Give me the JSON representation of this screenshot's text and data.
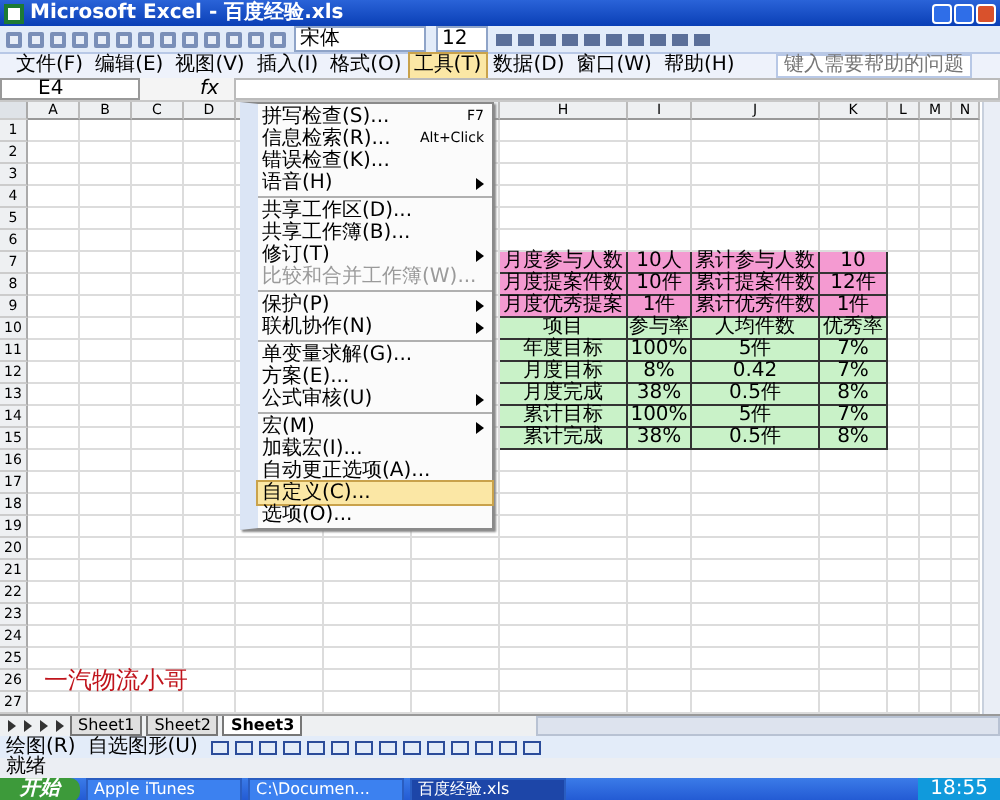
{
  "window": {
    "title": "Microsoft Excel - 百度经验.xls"
  },
  "toolbar": {
    "font": "宋体",
    "font_size": "12"
  },
  "menu_bar": [
    {
      "label": "文件(F)",
      "selected": false
    },
    {
      "label": "编辑(E)",
      "selected": false
    },
    {
      "label": "视图(V)",
      "selected": false
    },
    {
      "label": "插入(I)",
      "selected": false
    },
    {
      "label": "格式(O)",
      "selected": false
    },
    {
      "label": "工具(T)",
      "selected": true
    },
    {
      "label": "数据(D)",
      "selected": false
    },
    {
      "label": "窗口(W)",
      "selected": false
    },
    {
      "label": "帮助(H)",
      "selected": false
    }
  ],
  "help_box": {
    "placeholder": "键入需要帮助的问题"
  },
  "formula_bar": {
    "name_box": "E4",
    "function_label": "fx"
  },
  "columns": [
    "A",
    "B",
    "C",
    "D",
    "H",
    "I",
    "J",
    "K",
    "L",
    "M",
    "N"
  ],
  "rows": [
    "1",
    "2",
    "3",
    "4",
    "5",
    "6",
    "7",
    "8",
    "9",
    "10",
    "11",
    "12",
    "13",
    "14",
    "15",
    "16",
    "17",
    "18",
    "19",
    "20",
    "21",
    "22",
    "23",
    "24",
    "25",
    "26",
    "27"
  ],
  "table": {
    "rows": [
      {
        "kind": "summary",
        "cells": [
          "月度参与人数",
          "10人",
          "累计参与人数",
          "10"
        ]
      },
      {
        "kind": "summary",
        "cells": [
          "月度提案件数",
          "10件",
          "累计提案件数",
          "12件"
        ]
      },
      {
        "kind": "summary",
        "cells": [
          "月度优秀提案",
          "1件",
          "累计优秀件数",
          "1件"
        ]
      },
      {
        "kind": "data",
        "cells": [
          "项目",
          "参与率",
          "人均件数",
          "优秀率"
        ]
      },
      {
        "kind": "data",
        "cells": [
          "年度目标",
          "100%",
          "5件",
          "7%"
        ]
      },
      {
        "kind": "data",
        "cells": [
          "月度目标",
          "8%",
          "0.42",
          "7%"
        ]
      },
      {
        "kind": "data",
        "cells": [
          "月度完成",
          "38%",
          "0.5件",
          "8%"
        ]
      },
      {
        "kind": "data",
        "cells": [
          "累计目标",
          "100%",
          "5件",
          "7%"
        ]
      },
      {
        "kind": "data",
        "cells": [
          "累计完成",
          "38%",
          "0.5件",
          "8%"
        ]
      }
    ]
  },
  "caption": "一汽物流小哥",
  "tools_menu": [
    {
      "kind": "item",
      "label": "拼写检查(S)...",
      "shortcut": "F7",
      "selected": false,
      "disabled": false
    },
    {
      "kind": "item",
      "label": "信息检索(R)...",
      "shortcut": "Alt+Click",
      "selected": false,
      "disabled": false
    },
    {
      "kind": "item",
      "label": "错误检查(K)...",
      "selected": false,
      "disabled": false
    },
    {
      "kind": "submenu",
      "label": "语音(H)",
      "selected": false,
      "disabled": false
    },
    {
      "kind": "separator"
    },
    {
      "kind": "item",
      "label": "共享工作区(D)...",
      "selected": false,
      "disabled": false
    },
    {
      "kind": "item",
      "label": "共享工作簿(B)...",
      "selected": false,
      "disabled": false
    },
    {
      "kind": "submenu",
      "label": "修订(T)",
      "selected": false,
      "disabled": false
    },
    {
      "kind": "item",
      "label": "比较和合并工作簿(W)...",
      "selected": false,
      "disabled": true
    },
    {
      "kind": "separator"
    },
    {
      "kind": "submenu",
      "label": "保护(P)",
      "selected": false,
      "disabled": false
    },
    {
      "kind": "submenu",
      "label": "联机协作(N)",
      "selected": false,
      "disabled": false
    },
    {
      "kind": "separator"
    },
    {
      "kind": "item",
      "label": "单变量求解(G)...",
      "selected": false,
      "disabled": false
    },
    {
      "kind": "item",
      "label": "方案(E)...",
      "selected": false,
      "disabled": false
    },
    {
      "kind": "submenu",
      "label": "公式审核(U)",
      "selected": false,
      "disabled": false
    },
    {
      "kind": "separator"
    },
    {
      "kind": "submenu",
      "label": "宏(M)",
      "selected": false,
      "disabled": false
    },
    {
      "kind": "item",
      "label": "加载宏(I)...",
      "selected": false,
      "disabled": false
    },
    {
      "kind": "item",
      "label": "自动更正选项(A)...",
      "selected": false,
      "disabled": false
    },
    {
      "kind": "item",
      "label": "自定义(C)...",
      "selected": true,
      "disabled": false
    },
    {
      "kind": "item",
      "label": "选项(O)...",
      "selected": false,
      "disabled": false
    }
  ],
  "sheet_tabs": [
    {
      "label": "Sheet1",
      "selected": false
    },
    {
      "label": "Sheet2",
      "selected": false
    },
    {
      "label": "Sheet3",
      "selected": true
    }
  ],
  "drawing_toolbar": [
    "绘图(R)",
    "自选图形(U)"
  ],
  "status_bar": "就绪",
  "taskbar": {
    "start": "开始",
    "items": [
      {
        "label": "Apple iTunes",
        "selected": false
      },
      {
        "label": "C:\\Documen...",
        "selected": false
      },
      {
        "label": "百度经验.xls",
        "selected": true
      }
    ],
    "clock": "18:55"
  }
}
